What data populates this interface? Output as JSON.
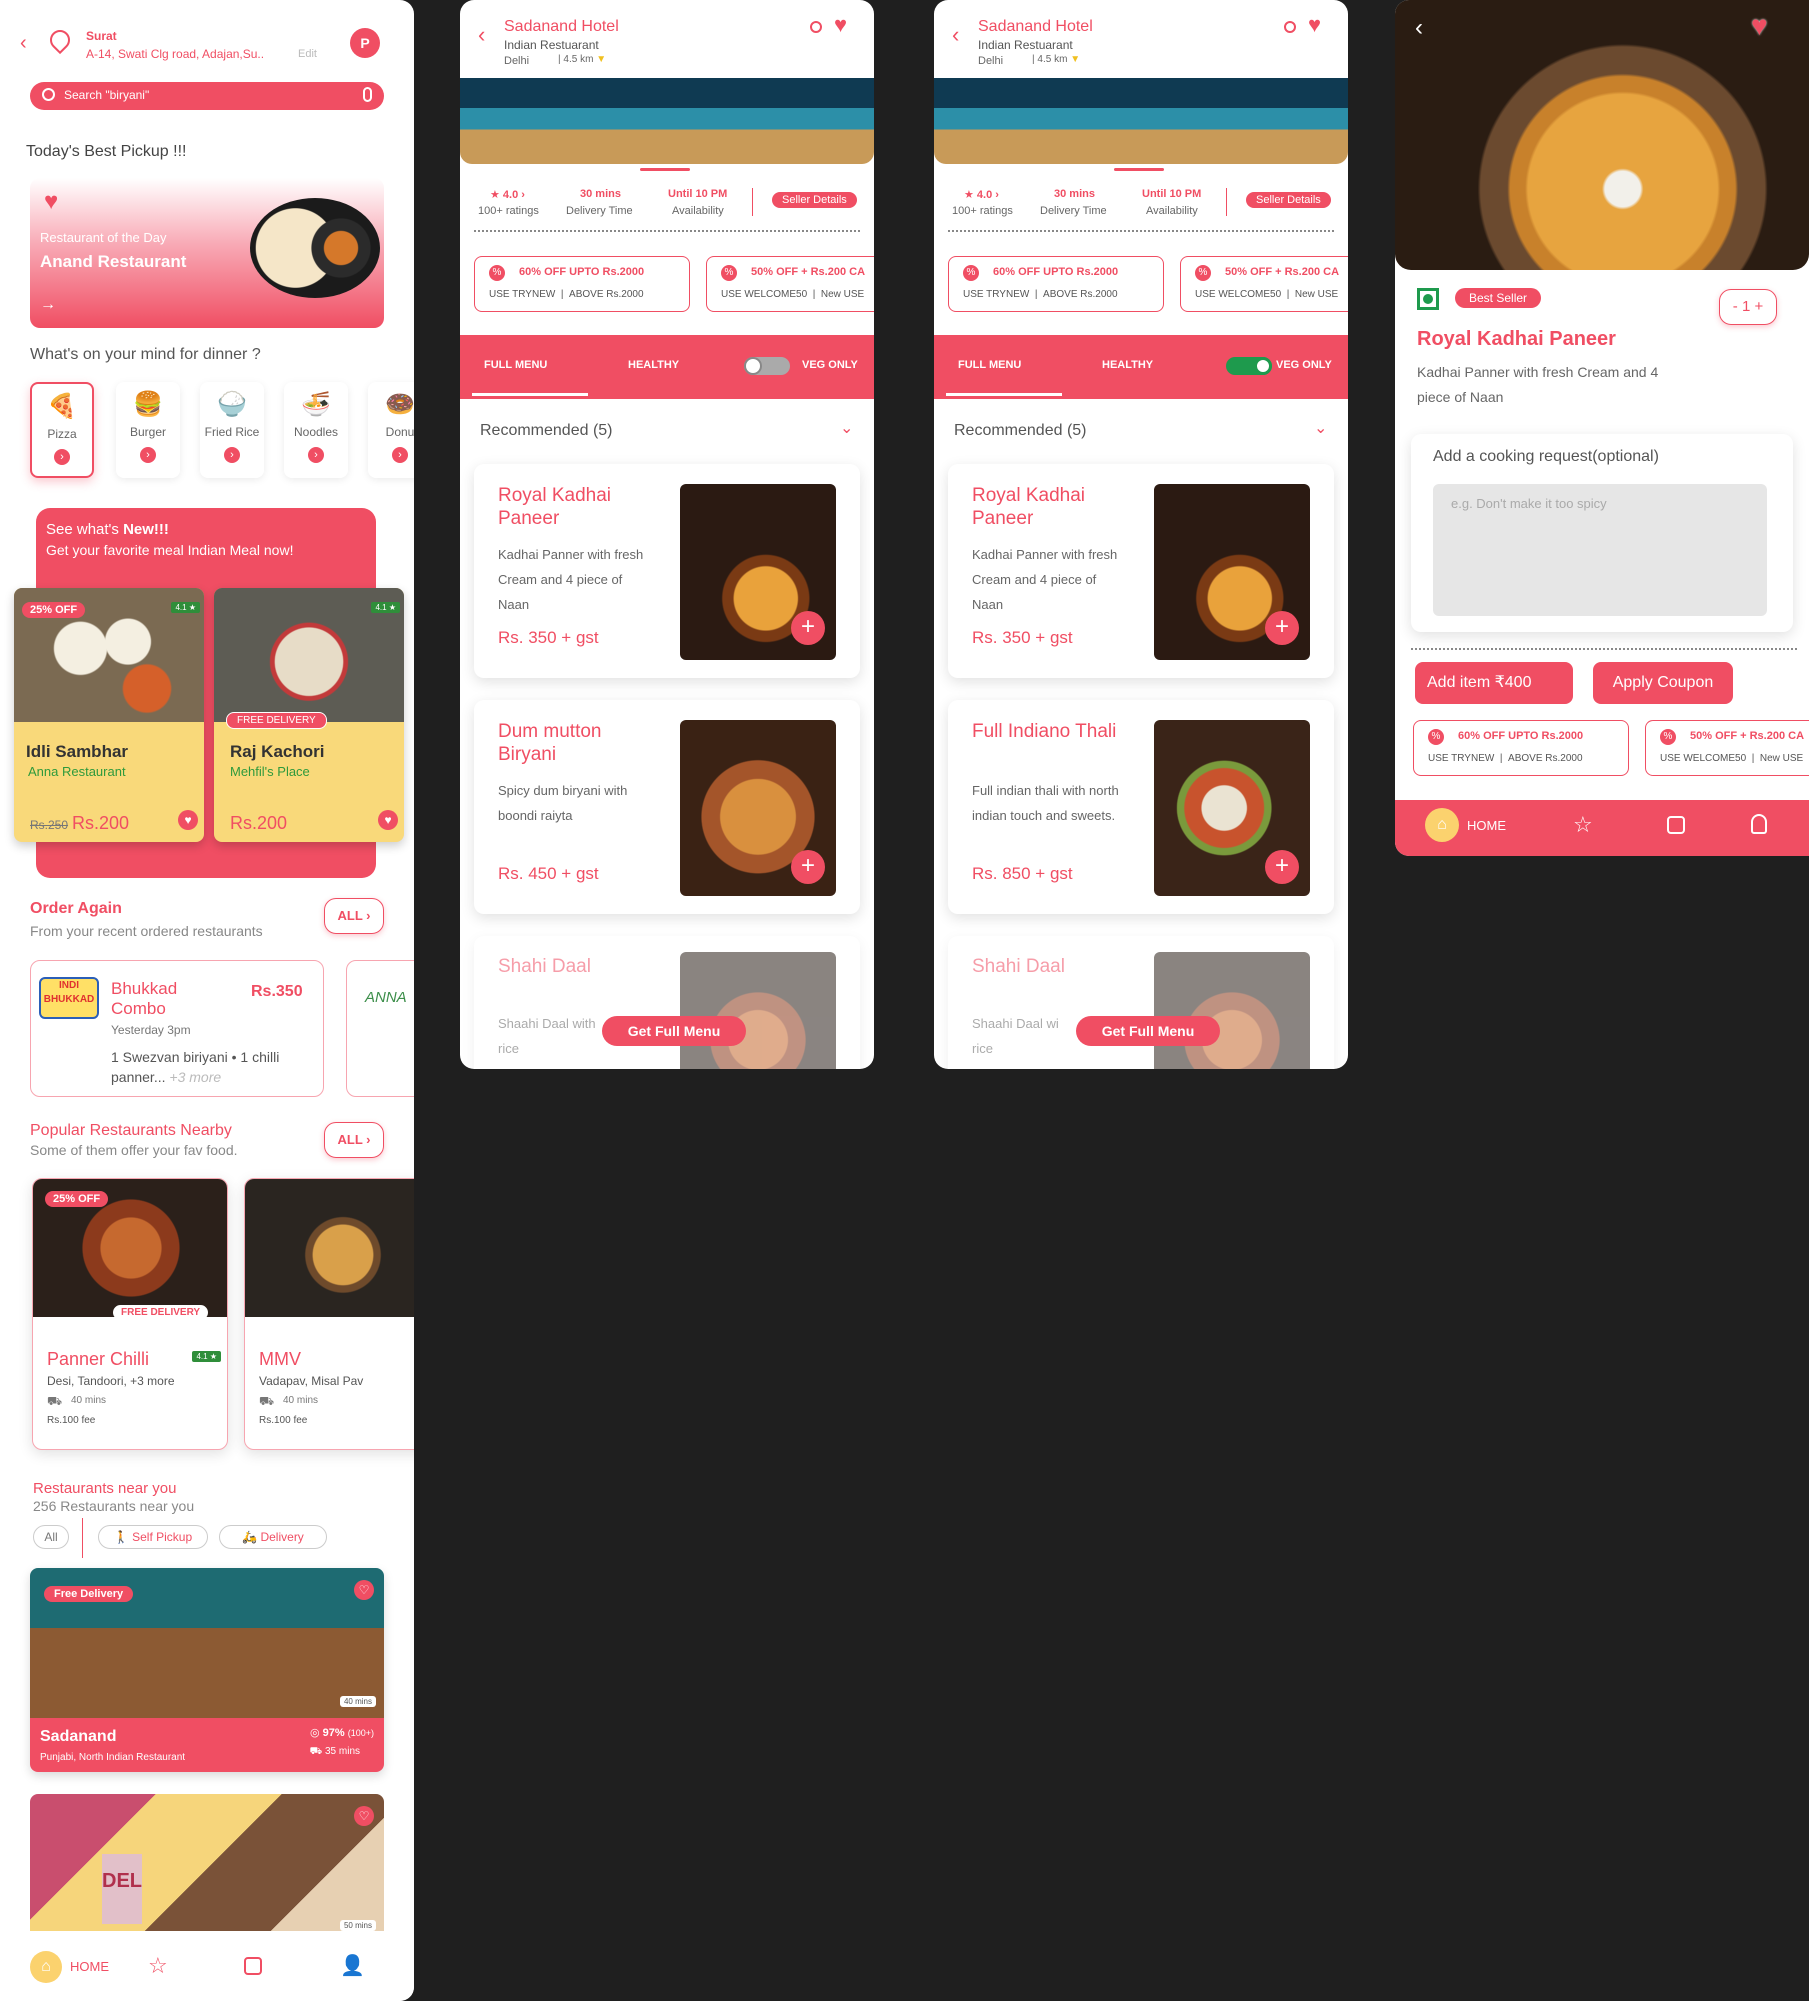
{
  "home": {
    "location": {
      "city": "Surat",
      "address": "A-14, Swati Clg road, Adajan,Su..",
      "edit": "Edit",
      "avatar": "P"
    },
    "search": {
      "placeholder": "Search \"biryani\""
    },
    "best_pickup": {
      "heading": "Today's Best Pickup !!!",
      "sub": "Restaurant of the Day",
      "name": "Anand Restaurant",
      "arrow": "→"
    },
    "mind": {
      "heading": "What's on your mind for dinner ?",
      "items": [
        {
          "label": "Pizza",
          "icon": "🍕"
        },
        {
          "label": "Burger",
          "icon": "🍔"
        },
        {
          "label": "Fried Rice",
          "icon": "🍚"
        },
        {
          "label": "Noodles",
          "icon": "🍜"
        },
        {
          "label": "Donu",
          "icon": "🍩"
        }
      ]
    },
    "new": {
      "line1a": "See what's ",
      "line1b": "New!!!",
      "line2": "Get your favorite meal Indian Meal now!"
    },
    "new_cards": [
      {
        "badge": "25% OFF",
        "rating": "4.1 ★",
        "name": "Idli Sambhar",
        "rest": "Anna Restaurant",
        "old": "Rs.250",
        "price": "Rs.200"
      },
      {
        "badge": "FREE DELIVERY",
        "rating": "4.1 ★",
        "name": "Raj Kachori",
        "rest": "Mehfil's Place",
        "price": "Rs.200"
      }
    ],
    "order_again": {
      "title": "Order Again",
      "sub": "From your recent ordered restaurants",
      "all": "ALL",
      "logo": "INDI BHUKKAD",
      "name": "Bhukkad Combo",
      "time": "Yesterday 3pm",
      "price": "Rs.350",
      "items": "1 Swezvan biriyani • 1 chilli panner...",
      "more": "+3 more",
      "logo2": "ANNA"
    },
    "popular": {
      "title": "Popular Restaurants Nearby",
      "sub": "Some of them offer your fav food.",
      "all": "ALL",
      "cards": [
        {
          "badge": "25% OFF",
          "delivery": "FREE DELIVERY",
          "name": "Panner Chilli",
          "rating": "4.1 ★",
          "cuisine": "Desi, Tandoori, +3 more",
          "time": "40 mins",
          "fee": "Rs.100 fee"
        },
        {
          "name": "MMV",
          "cuisine": "Vadapav, Misal Pav",
          "time": "40 mins",
          "fee": "Rs.100 fee"
        }
      ]
    },
    "near": {
      "title": "Restaurants near you",
      "sub": "256 Restaurants near you",
      "filters": [
        "All",
        "Self Pickup",
        "Delivery"
      ],
      "card1": {
        "badge": "Free Delivery",
        "time": "40 mins",
        "name": "Sadanand",
        "cuisine": "Punjabi, North Indian Restaurant",
        "score": "97%",
        "score_sub": "(100+)",
        "eta": "35 mins"
      },
      "card2": {
        "time": "50 mins",
        "sign": "DEL"
      }
    },
    "nav": {
      "home": "HOME"
    }
  },
  "menu": {
    "title": "Sadanand Hotel",
    "type": "Indian Restuarant",
    "city": "Delhi",
    "dist": "4.5 km",
    "stats": [
      {
        "v": "★ 4.0 ›",
        "l": "100+ ratings"
      },
      {
        "v": "30 mins",
        "l": "Delivery Time"
      },
      {
        "v": "Until 10 PM",
        "l": "Availability"
      }
    ],
    "seller": "Seller Details",
    "offers": [
      {
        "t": "60% OFF UPTO Rs.2000",
        "s1": "USE TRYNEW",
        "s2": "ABOVE Rs.2000"
      },
      {
        "t": "50% OFF + Rs.200 CA",
        "s1": "USE WELCOME50",
        "s2": "New USE"
      }
    ],
    "tabs": [
      "FULL MENU",
      "HEALTHY",
      "VEG ONLY"
    ],
    "recommended": "Recommended (5)",
    "get_full": "Get Full Menu",
    "items_a": [
      {
        "name": "Royal Kadhai Paneer",
        "desc": "Kadhai Panner with fresh Cream and 4 piece of Naan",
        "price": "Rs. 350 + gst"
      },
      {
        "name": "Dum  mutton Biryani",
        "desc": "Spicy dum biryani with boondi raiyta",
        "price": "Rs. 450 + gst"
      },
      {
        "name": "Shahi Daal",
        "desc": "Shaahi Daal with",
        "desc2": "rice"
      }
    ],
    "items_b": [
      {
        "name": "Royal Kadhai Paneer",
        "desc": "Kadhai Panner with fresh Cream and 4 piece of Naan",
        "price": "Rs. 350 + gst"
      },
      {
        "name": "Full Indiano Thali",
        "desc": "Full indian thali with north indian touch and sweets.",
        "price": "Rs. 850 + gst"
      },
      {
        "name": "Shahi Daal",
        "desc": "Shaahi Daal wi",
        "desc2": "rice"
      }
    ]
  },
  "detail": {
    "badge": "Best Seller",
    "qty": "1",
    "minus": "-",
    "plus": "+",
    "name": "Royal Kadhai Paneer",
    "desc": "Kadhai Panner with fresh Cream and 4 piece of Naan",
    "request_label": "Add a cooking request(optional)",
    "request_placeholder": "e.g.  Don't make it too spicy",
    "add": "Add item ₹400",
    "coupon": "Apply Coupon",
    "offers": [
      {
        "t": "60% OFF UPTO Rs.2000",
        "s1": "USE TRYNEW",
        "s2": "ABOVE Rs.2000"
      },
      {
        "t": "50% OFF + Rs.200 CA",
        "s1": "USE WELCOME50",
        "s2": "New USE"
      }
    ],
    "nav": {
      "home": "HOME"
    }
  },
  "colors": {
    "accent": "#f04e63",
    "veg_green": "#1e9a4d",
    "yellow": "#f9d97a"
  }
}
